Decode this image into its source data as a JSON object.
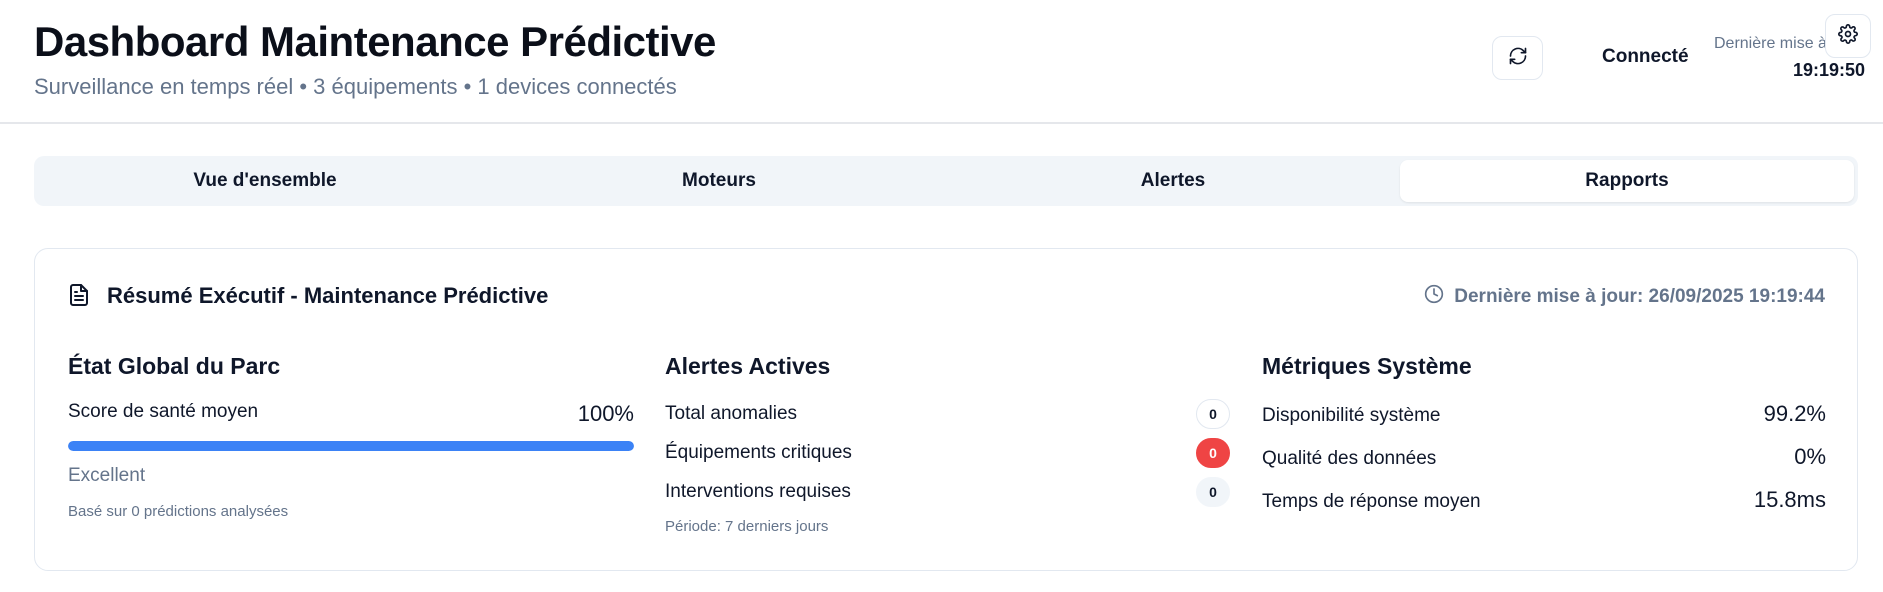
{
  "header": {
    "title": "Dashboard Maintenance Prédictive",
    "subtitle": "Surveillance en temps réel • 3 équipements • 1 devices connectés",
    "refresh_icon": "refresh-icon",
    "connection_status": "Connecté",
    "last_update_label": "Dernière mise à",
    "last_update_time": "19:19:50",
    "settings_icon": "gear-icon"
  },
  "tabs": [
    {
      "label": "Vue d'ensemble",
      "active": false
    },
    {
      "label": "Moteurs",
      "active": false
    },
    {
      "label": "Alertes",
      "active": false
    },
    {
      "label": "Rapports",
      "active": true
    }
  ],
  "summary": {
    "icon": "document-icon",
    "title": "Résumé Exécutif - Maintenance Prédictive",
    "update_icon": "clock-icon",
    "last_update": "Dernière mise à jour: 26/09/2025 19:19:44",
    "global_state": {
      "title": "État Global du Parc",
      "score_label": "Score de santé moyen",
      "score_value": "100%",
      "score_fraction": 1.0,
      "status": "Excellent",
      "basis": "Basé sur 0 prédictions analysées"
    },
    "alerts": {
      "title": "Alertes Actives",
      "rows": [
        {
          "label": "Total anomalies",
          "count": "0",
          "style": "outline"
        },
        {
          "label": "Équipements critiques",
          "count": "0",
          "style": "critical"
        },
        {
          "label": "Interventions requises",
          "count": "0",
          "style": "neutral"
        }
      ],
      "period": "Période: 7 derniers jours"
    },
    "metrics": {
      "title": "Métriques Système",
      "rows": [
        {
          "label": "Disponibilité système",
          "value": "99.2%"
        },
        {
          "label": "Qualité des données",
          "value": "0%"
        },
        {
          "label": "Temps de réponse moyen",
          "value": "15.8ms"
        }
      ]
    }
  },
  "colors": {
    "accent": "#3b82f6",
    "critical": "#ef4444",
    "muted_text": "#64748b"
  }
}
